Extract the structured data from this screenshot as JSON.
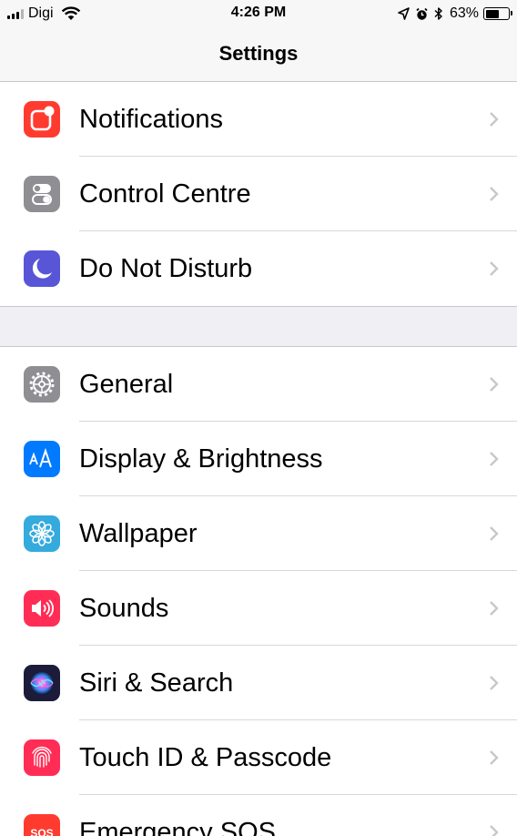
{
  "status_bar": {
    "carrier": "Digi",
    "time": "4:26 PM",
    "battery_percent": "63%",
    "battery_level": 0.63
  },
  "nav": {
    "title": "Settings"
  },
  "group1": [
    {
      "label": "Notifications",
      "icon": "notifications-icon",
      "color": "#ff3b30"
    },
    {
      "label": "Control Centre",
      "icon": "control-centre-icon",
      "color": "#8e8e93"
    },
    {
      "label": "Do Not Disturb",
      "icon": "moon-icon",
      "color": "#5856d6"
    }
  ],
  "group2": [
    {
      "label": "General",
      "icon": "gear-icon",
      "color": "#8e8e93"
    },
    {
      "label": "Display & Brightness",
      "icon": "display-brightness-icon",
      "color": "#007aff"
    },
    {
      "label": "Wallpaper",
      "icon": "wallpaper-flower-icon",
      "color": "#35aadc"
    },
    {
      "label": "Sounds",
      "icon": "speaker-icon",
      "color": "#ff2d55"
    },
    {
      "label": "Siri & Search",
      "icon": "siri-icon",
      "color": "#1c1c3a"
    },
    {
      "label": "Touch ID & Passcode",
      "icon": "fingerprint-icon",
      "color": "#ff2d55"
    },
    {
      "label": "Emergency SOS",
      "icon": "sos-icon",
      "icon_text": "SOS",
      "color": "#ff3b30"
    }
  ]
}
